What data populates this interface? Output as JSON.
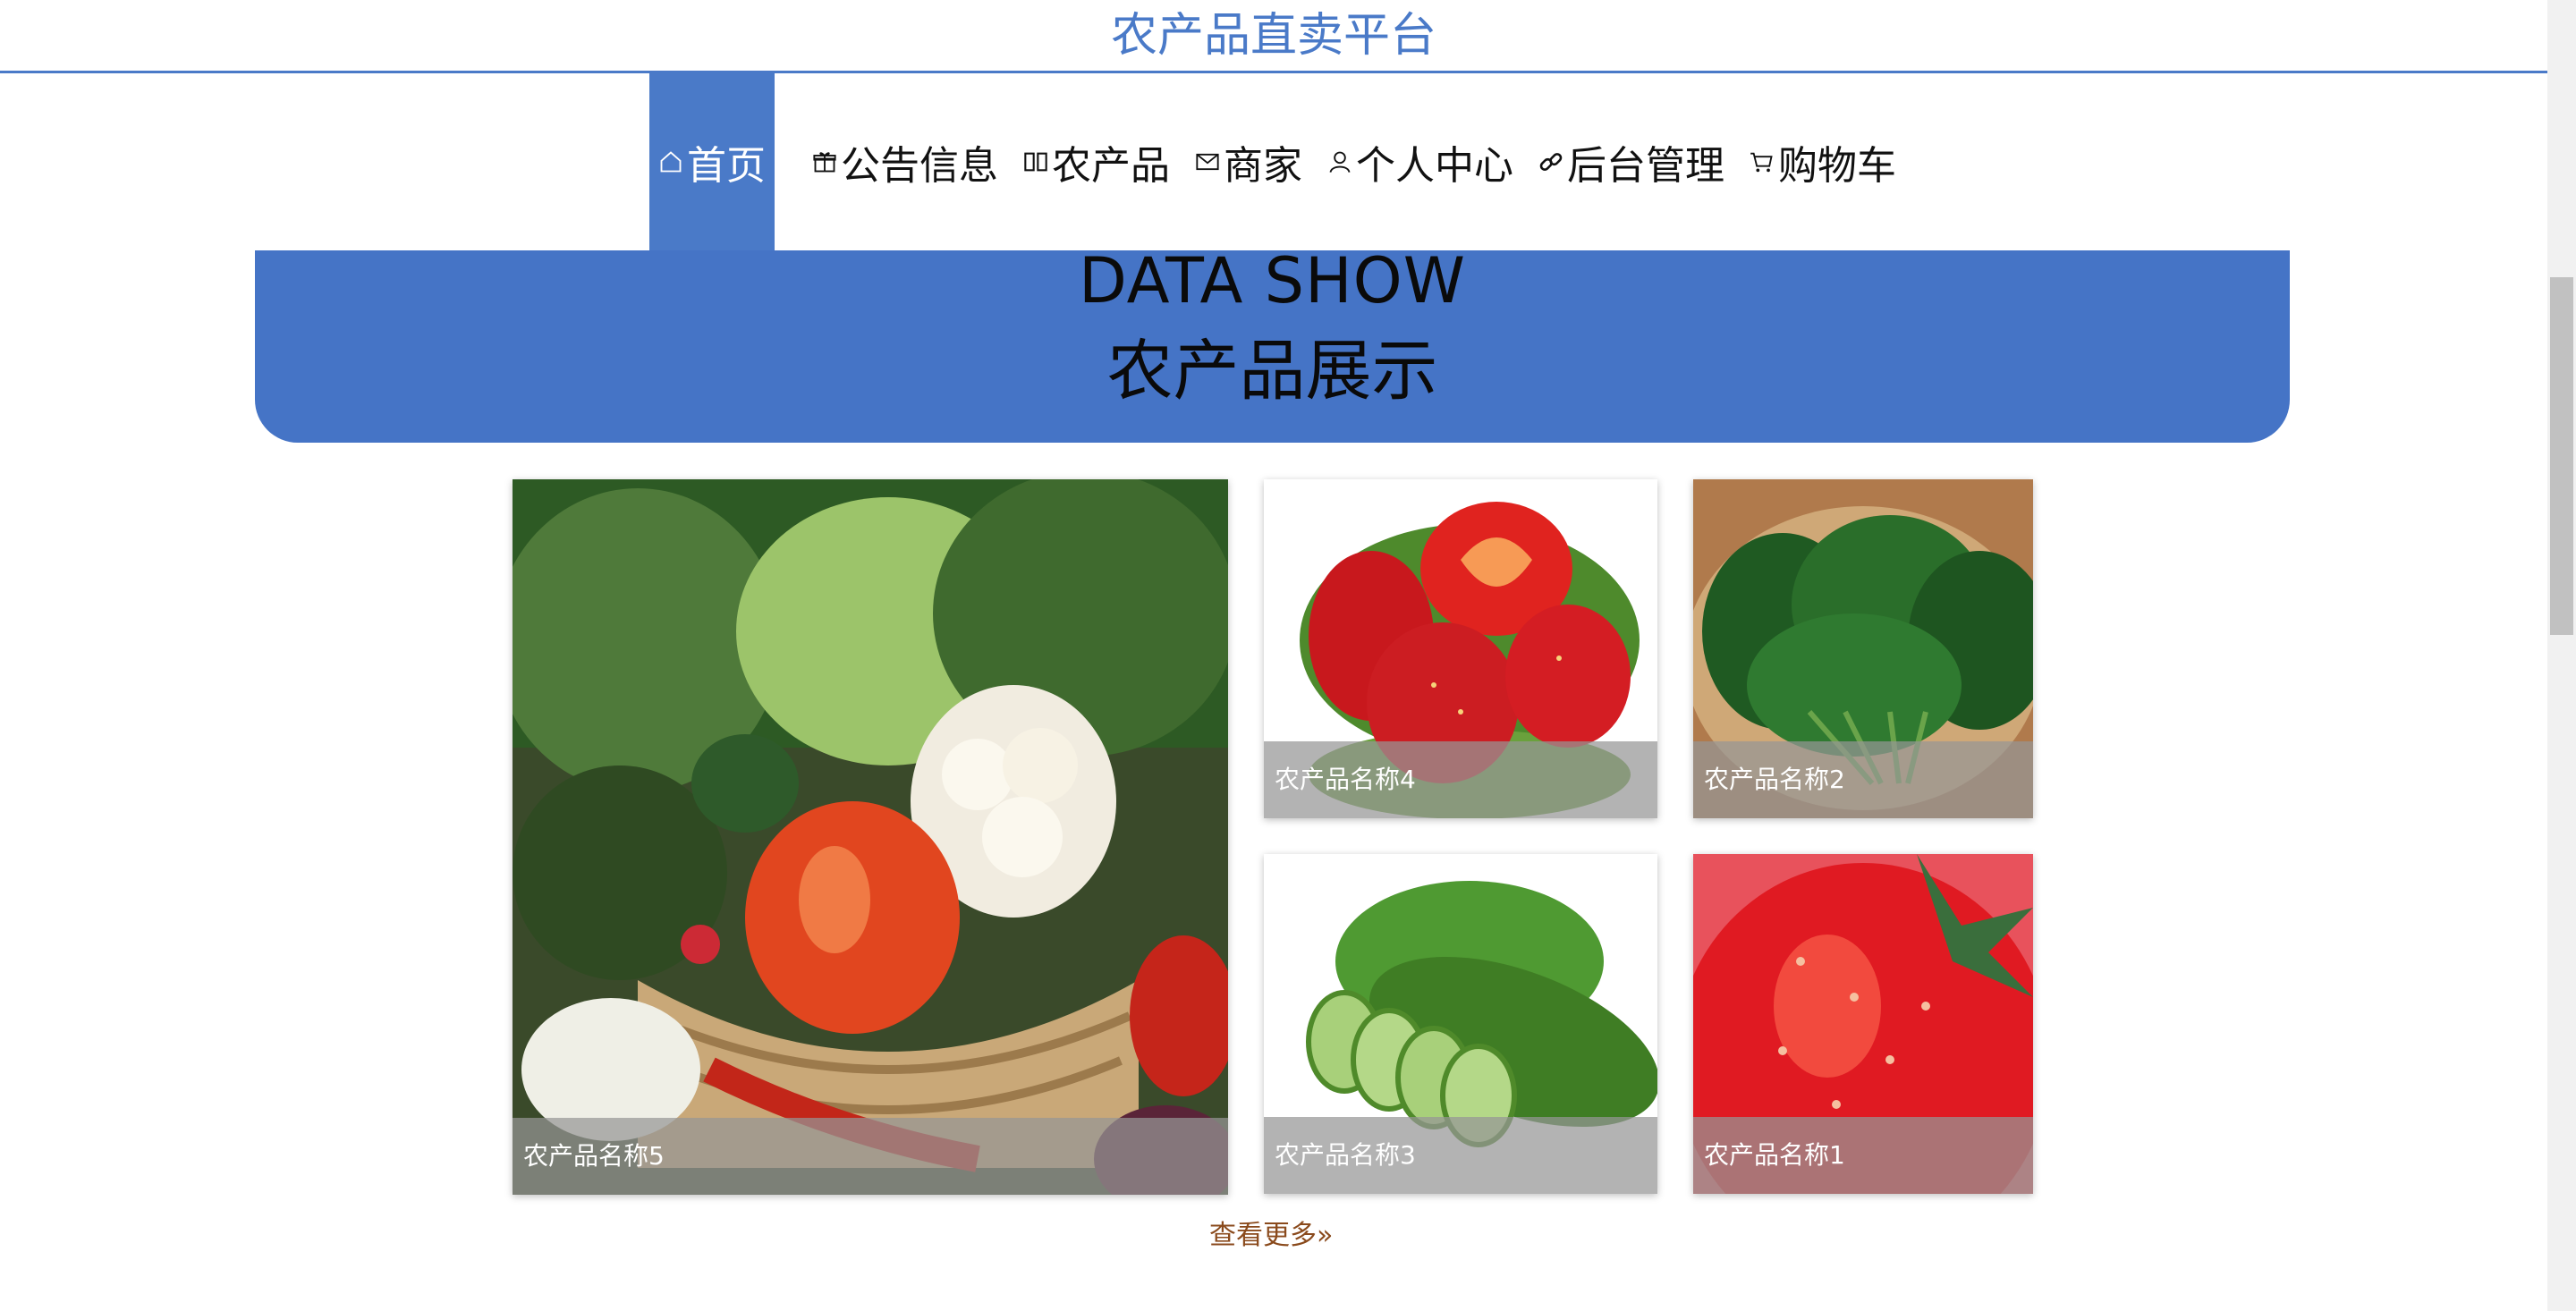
{
  "site": {
    "title": "农产品直卖平台"
  },
  "nav": {
    "items": [
      {
        "label": "首页",
        "icon": "home-icon",
        "active": true
      },
      {
        "label": "公告信息",
        "icon": "gift-icon"
      },
      {
        "label": "农产品",
        "icon": "columns-icon"
      },
      {
        "label": "商家",
        "icon": "mail-icon"
      },
      {
        "label": "个人中心",
        "icon": "user-icon"
      },
      {
        "label": "后台管理",
        "icon": "link-icon"
      },
      {
        "label": "购物车",
        "icon": "cart-icon"
      }
    ]
  },
  "banner": {
    "en": "DATA SHOW",
    "cn": "农产品展示"
  },
  "products": [
    {
      "name": "农产品名称5",
      "image": "vegetable-basket"
    },
    {
      "name": "农产品名称4",
      "image": "strawberries"
    },
    {
      "name": "农产品名称2",
      "image": "spinach"
    },
    {
      "name": "农产品名称3",
      "image": "cucumber"
    },
    {
      "name": "农产品名称1",
      "image": "strawberry-closeup"
    }
  ],
  "more_link": "查看更多»",
  "colors": {
    "accent": "#4a7ac8",
    "banner": "#4574c6",
    "more_link": "#8a4a1c"
  }
}
